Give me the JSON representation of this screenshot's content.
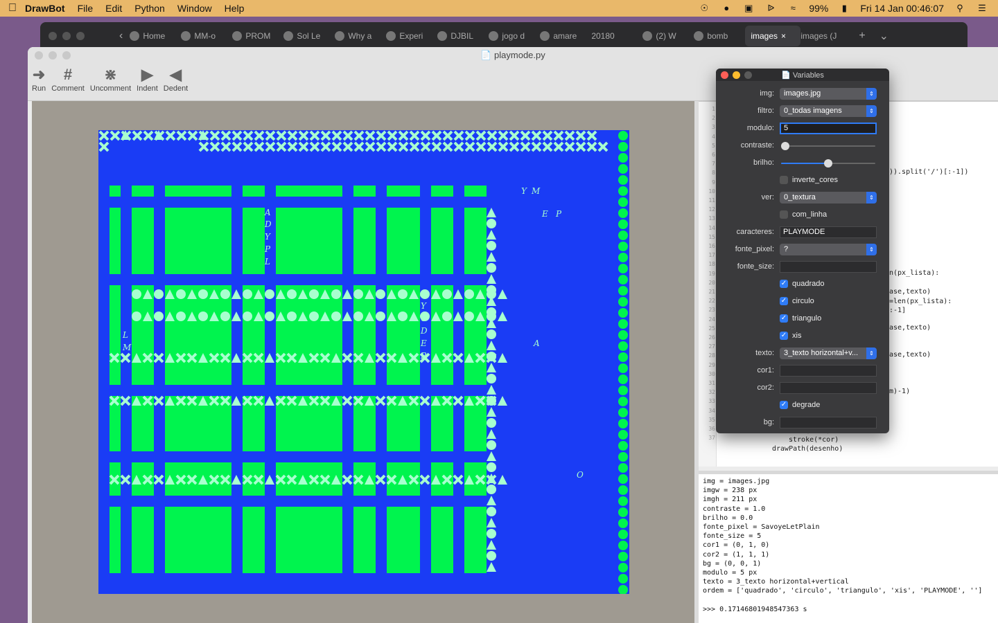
{
  "menubar": {
    "app": "DrawBot",
    "items": [
      "File",
      "Edit",
      "Python",
      "Window",
      "Help"
    ],
    "battery": "99%",
    "datetime": "Fri 14 Jan  00:46:07"
  },
  "browser": {
    "tabs": [
      "Home",
      "MM-o",
      "PROM",
      "Sol Le",
      "Why a",
      "Experi",
      "DJBIL",
      "jogo d",
      "amare",
      "20180",
      "(2) W",
      "bomb",
      "images",
      "images (J"
    ],
    "active_tab": "images"
  },
  "window": {
    "title": "playmode.py",
    "toolbar": {
      "run": "Run",
      "comment": "Comment",
      "uncomment": "Uncomment",
      "indent": "Indent",
      "dedent": "Dedent"
    }
  },
  "colors": {
    "canvas_bg": "#1a3cf5",
    "shape": "#00f44e",
    "light": "#a8ffcf"
  },
  "canvas_letters": [
    "Y",
    "M",
    "E",
    "P",
    "A",
    "A",
    "D",
    "Y",
    "P",
    "L",
    "A",
    "Y",
    "O",
    "D",
    "E",
    "P",
    "L",
    "M",
    "O"
  ],
  "variables": {
    "title": "Variables",
    "img_label": "img:",
    "img_value": "images.jpg",
    "filtro_label": "filtro:",
    "filtro_value": "0_todas imagens",
    "modulo_label": "modulo:",
    "modulo_value": "5",
    "contraste_label": "contraste:",
    "contraste_level": 0.0,
    "brilho_label": "brilho:",
    "brilho_level": 0.5,
    "inverte_label": "inverte_cores",
    "ver_label": "ver:",
    "ver_value": "0_textura",
    "com_linha_label": "com_linha",
    "caracteres_label": "caracteres:",
    "caracteres_value": "PLAYMODE",
    "fonte_pixel_label": "fonte_pixel:",
    "fonte_pixel_value": "?",
    "fonte_size_label": "fonte_size:",
    "fonte_size_value": "",
    "quadrado_label": "quadrado",
    "circulo_label": "circulo",
    "triangulo_label": "triangulo",
    "xis_label": "xis",
    "texto_label": "texto:",
    "texto_value": "3_texto horizontal+v...",
    "cor1_label": "cor1:",
    "cor1_value": "",
    "cor2_label": "cor2:",
    "cor2_value": "",
    "degrade_label": "degrade",
    "bg_label": "bg:",
    "bg_value": ""
  },
  "code": {
    "line_numbers": [
      "1",
      "2",
      "3",
      "4",
      "5",
      "6",
      "7",
      "8",
      "9",
      "10",
      "11",
      "12",
      "13",
      "14",
      "15",
      "16",
      "17",
      "18",
      "19",
      "20",
      "21",
      "22",
      "23",
      "24",
      "25",
      "26",
      "27",
      "28",
      "29",
      "30",
      "31",
      "32",
      "33",
      "34",
      "35",
      "36",
      "37"
    ],
    "frag_8": ")).split('/')[:-1])",
    "frag_19": "n(px_lista):",
    "frag_20a": "ase,texto)",
    "frag_21": "=len(px_lista):",
    "frag_22": ":-1]",
    "frag_23": "ase,texto)",
    "frag_25": "ase,texto)",
    "frag_29": "m)-1)",
    "frag_34": "fill(None)",
    "frag_35": "stroke(*cor)",
    "frag_36": "drawPath(desenho)"
  },
  "output": [
    "img = images.jpg",
    "imgw = 238 px",
    "imgh = 211 px",
    "contraste = 1.0",
    "brilho = 0.0",
    "fonte_pixel = SavoyeLetPlain",
    "fonte_size = 5",
    "cor1 = (0, 1, 0)",
    "cor2 = (1, 1, 1)",
    "bg = (0, 0, 1)",
    "modulo = 5 px",
    "texto = 3_texto horizontal+vertical",
    "ordem = ['quadrado', 'circulo', 'triangulo', 'xis', 'PLAYMODE', '']",
    "",
    ">>> 0.17146801948547363 s"
  ]
}
